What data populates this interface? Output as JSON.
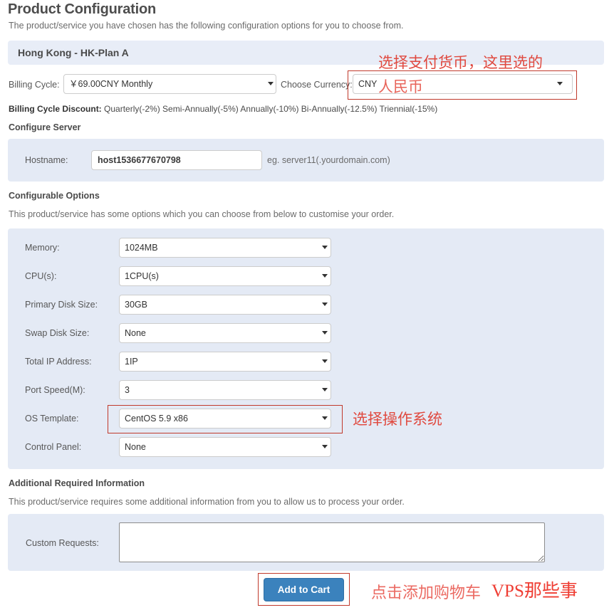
{
  "page": {
    "title": "Product Configuration",
    "subtitle": "The product/service you have chosen has the following configuration options for you to choose from."
  },
  "product_panel": {
    "heading": "Hong Kong - HK-Plan A",
    "billing_cycle_label": "Billing Cycle:",
    "billing_cycle_value": "￥69.00CNY Monthly",
    "choose_currency_label": "Choose Currency:",
    "currency_value": "CNY",
    "discount_label": "Billing Cycle Discount:",
    "discount_value": "Quarterly(-2%) Semi-Annually(-5%) Annually(-10%) Bi-Annually(-12.5%) Triennial(-15%)"
  },
  "configure_server": {
    "section_title": "Configure Server",
    "hostname_label": "Hostname:",
    "hostname_value": "host1536677670798",
    "hostname_hint": "eg. server11(.yourdomain.com)"
  },
  "configurable_options": {
    "section_title": "Configurable Options",
    "section_desc": "This product/service has some options which you can choose from below to customise your order.",
    "rows": [
      {
        "label": "Memory:",
        "value": "1024MB"
      },
      {
        "label": "CPU(s):",
        "value": "1CPU(s)"
      },
      {
        "label": "Primary Disk Size:",
        "value": "30GB"
      },
      {
        "label": "Swap Disk Size:",
        "value": "None"
      },
      {
        "label": "Total IP Address:",
        "value": "1IP"
      },
      {
        "label": "Port Speed(M):",
        "value": "3"
      },
      {
        "label": "OS Template:",
        "value": "CentOS 5.9 x86"
      },
      {
        "label": "Control Panel:",
        "value": "None"
      }
    ]
  },
  "additional_info": {
    "section_title": "Additional Required Information",
    "section_desc": "This product/service requires some additional information from you to allow us to process your order.",
    "custom_requests_label": "Custom Requests:",
    "custom_requests_value": "",
    "custom_requests_placeholder": ""
  },
  "footer": {
    "add_to_cart_label": "Add to Cart"
  },
  "annotations": {
    "currency_line1": "选择支付货币，这里选的",
    "currency_line2": "人民币",
    "os_template": "选择操作系统",
    "add_to_cart": "点击添加购物车",
    "watermark": "VPS那些事"
  },
  "colors": {
    "panel_body": "#e4eaf5",
    "panel_heading": "#e8edf7",
    "button_primary": "#3b82bd",
    "annotation_red": "#e0493f",
    "watermark_red": "#ef3d33"
  }
}
